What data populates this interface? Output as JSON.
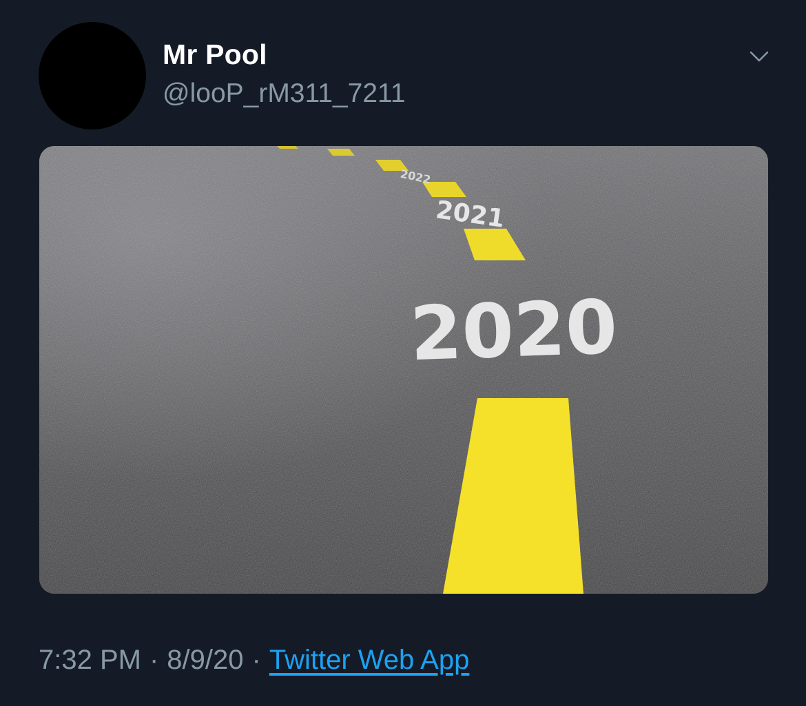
{
  "tweet": {
    "display_name": "Mr Pool",
    "handle": "@looP_rM311_7211",
    "time": "7:32 PM",
    "separator": "·",
    "date": "8/9/20",
    "source": "Twitter Web App",
    "menu_icon": "chevron-down-icon"
  },
  "media": {
    "road_labels": [
      "2020",
      "2021",
      "2022"
    ]
  },
  "colors": {
    "background": "#151b26",
    "name": "#ffffff",
    "secondary_text": "#8899a6",
    "link": "#1da1f2",
    "asphalt": "#4a4a4c",
    "road_line": "#f5e12a"
  }
}
